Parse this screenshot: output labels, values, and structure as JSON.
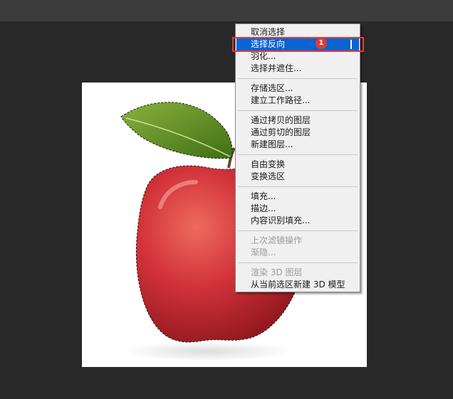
{
  "menu": {
    "items": [
      {
        "label": "取消选择",
        "state": "enabled"
      },
      {
        "label": "选择反向",
        "state": "highlighted"
      },
      {
        "label": "羽化...",
        "state": "enabled"
      },
      {
        "label": "选择并遮住...",
        "state": "enabled"
      },
      {
        "label": "存储选区...",
        "state": "enabled"
      },
      {
        "label": "建立工作路径...",
        "state": "enabled"
      },
      {
        "label": "通过拷贝的图层",
        "state": "enabled"
      },
      {
        "label": "通过剪切的图层",
        "state": "enabled"
      },
      {
        "label": "新建图层...",
        "state": "enabled"
      },
      {
        "label": "自由变换",
        "state": "enabled"
      },
      {
        "label": "变换选区",
        "state": "enabled"
      },
      {
        "label": "填充...",
        "state": "enabled"
      },
      {
        "label": "描边...",
        "state": "enabled"
      },
      {
        "label": "内容识别填充...",
        "state": "enabled"
      },
      {
        "label": "上次滤镜操作",
        "state": "disabled"
      },
      {
        "label": "渐隐...",
        "state": "disabled"
      },
      {
        "label": "渲染 3D 图层",
        "state": "disabled"
      },
      {
        "label": "从当前选区新建 3D 模型",
        "state": "enabled"
      }
    ]
  },
  "annotation": {
    "badge_text": "1",
    "frame_color": "#e53935"
  },
  "colors": {
    "highlight": "#0a64d2",
    "background": "#282828",
    "menu_bg": "#f0f0f0"
  },
  "icons": {
    "canvas_image": "apple-photo-icon"
  }
}
